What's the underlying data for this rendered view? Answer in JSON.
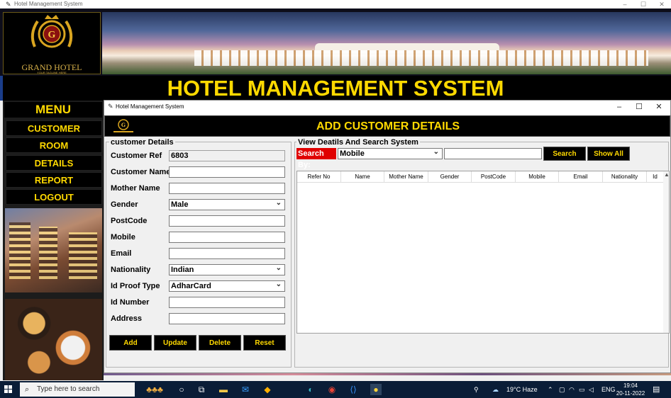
{
  "window": {
    "title": "Hotel Management System",
    "minimize": "–",
    "maximize": "☐",
    "close": "✕"
  },
  "logo": {
    "name": "GRAND HOTEL",
    "tagline": "YOUR TAGLINE HERE"
  },
  "header": {
    "title": "HOTEL MANAGEMENT SYSTEM"
  },
  "menu": {
    "title": "MENU",
    "items": [
      "CUSTOMER",
      "ROOM",
      "DETAILS",
      "REPORT",
      "LOGOUT"
    ]
  },
  "child_window": {
    "title": "Hotel Management System",
    "minimize": "–",
    "maximize": "☐",
    "close": "✕"
  },
  "form": {
    "heading": "ADD CUSTOMER DETAILS",
    "section_label": "customer Details",
    "fields": {
      "customer_ref": {
        "label": "Customer Ref",
        "value": "6803"
      },
      "customer_name": {
        "label": "Customer Name:",
        "value": ""
      },
      "mother_name": {
        "label": "Mother Name",
        "value": ""
      },
      "gender": {
        "label": "Gender",
        "value": "Male"
      },
      "postcode": {
        "label": "PostCode",
        "value": ""
      },
      "mobile": {
        "label": "Mobile",
        "value": ""
      },
      "email": {
        "label": "Email",
        "value": ""
      },
      "nationality": {
        "label": "Nationality",
        "value": "Indian"
      },
      "id_proof": {
        "label": "Id Proof Type",
        "value": "AdharCard"
      },
      "id_number": {
        "label": "Id Number",
        "value": ""
      },
      "address": {
        "label": "Address",
        "value": ""
      }
    },
    "buttons": {
      "add": "Add",
      "update": "Update",
      "delete": "Delete",
      "reset": "Reset"
    }
  },
  "search": {
    "section_label": "View Deatils And Search System",
    "by_label": "Search By:",
    "by_value": "Mobile",
    "search_button": "Search",
    "show_all_button": "Show All"
  },
  "table": {
    "columns": [
      "Refer No",
      "Name",
      "Mother Name",
      "Gender",
      "PostCode",
      "Mobile",
      "Email",
      "Nationality",
      "Id"
    ]
  },
  "taskbar": {
    "search_placeholder": "Type here to search",
    "weather": "19°C  Haze",
    "language": "ENG",
    "time": "19:04",
    "date": "20-11-2022"
  }
}
